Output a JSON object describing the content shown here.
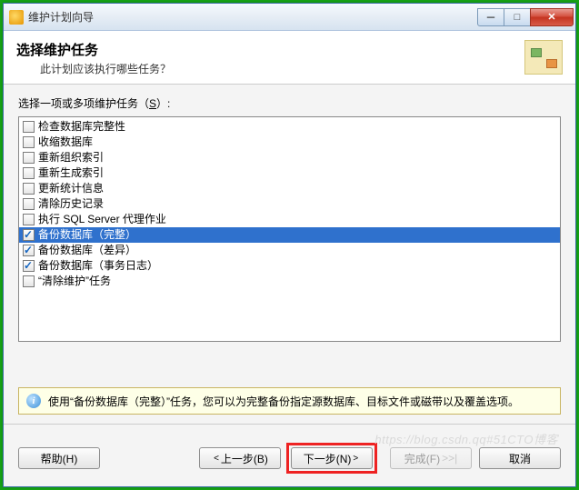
{
  "window": {
    "title": "维护计划向导"
  },
  "header": {
    "title": "选择维护任务",
    "subtitle": "此计划应该执行哪些任务？"
  },
  "list_label_pre": "选择一项或多项维护任务（",
  "list_label_u": "S",
  "list_label_post": "）:",
  "tasks": [
    {
      "label": "检查数据库完整性",
      "checked": false,
      "selected": false
    },
    {
      "label": "收缩数据库",
      "checked": false,
      "selected": false
    },
    {
      "label": "重新组织索引",
      "checked": false,
      "selected": false
    },
    {
      "label": "重新生成索引",
      "checked": false,
      "selected": false
    },
    {
      "label": "更新统计信息",
      "checked": false,
      "selected": false
    },
    {
      "label": "清除历史记录",
      "checked": false,
      "selected": false
    },
    {
      "label": "执行 SQL Server 代理作业",
      "checked": false,
      "selected": false
    },
    {
      "label": "备份数据库（完整）",
      "checked": true,
      "selected": true
    },
    {
      "label": "备份数据库（差异）",
      "checked": true,
      "selected": false
    },
    {
      "label": "备份数据库（事务日志）",
      "checked": true,
      "selected": false
    },
    {
      "label": "“清除维护”任务",
      "checked": false,
      "selected": false
    }
  ],
  "info": "使用“备份数据库（完整）”任务，您可以为完整备份指定源数据库、目标文件或磁带以及覆盖选项。",
  "buttons": {
    "help": "帮助(H)",
    "back": "上一步(B)",
    "next": "下一步(N)",
    "finish": "完成(F)",
    "cancel": "取消"
  },
  "watermark": "https://blog.csdn.qq#51CTO博客"
}
